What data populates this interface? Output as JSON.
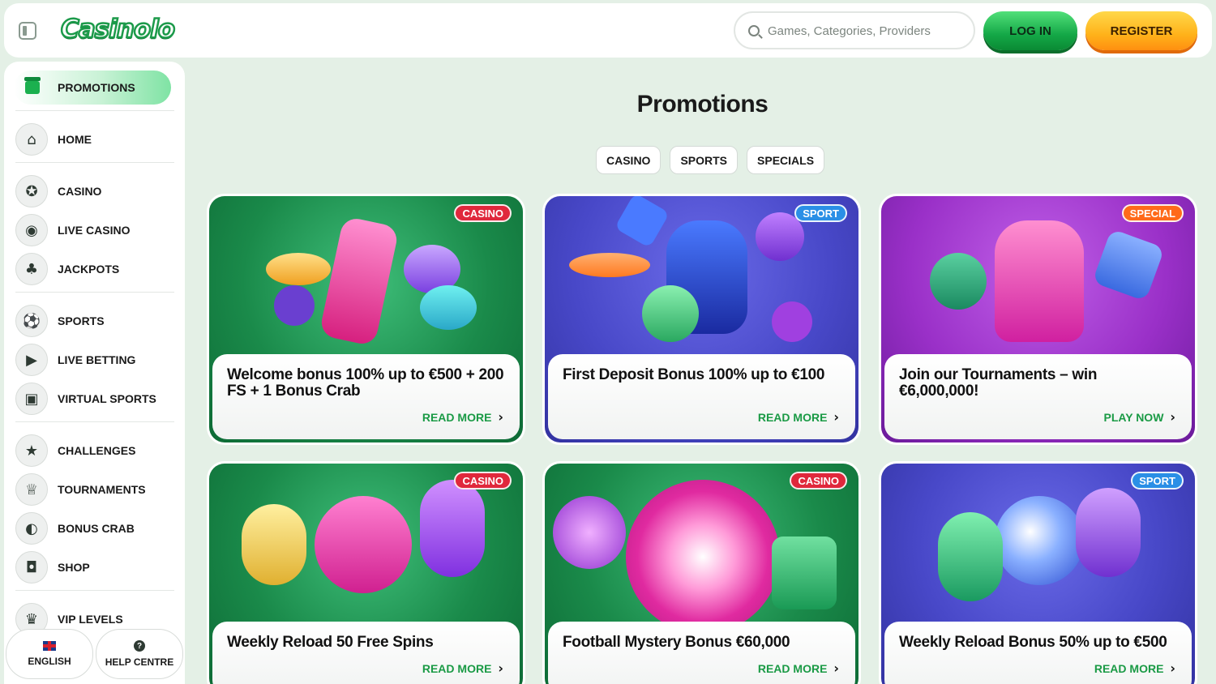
{
  "header": {
    "logo": "Casinolo",
    "search_placeholder": "Games, Categories, Providers",
    "login_label": "LOG IN",
    "register_label": "REGISTER"
  },
  "sidebar": {
    "promotions_label": "PROMOTIONS",
    "items": [
      {
        "label": "HOME",
        "icon": "home-icon",
        "glyph": "⌂"
      },
      {
        "label": "CASINO",
        "icon": "casino-chip-icon",
        "glyph": "✪"
      },
      {
        "label": "LIVE CASINO",
        "icon": "roulette-icon",
        "glyph": "◉"
      },
      {
        "label": "JACKPOTS",
        "icon": "club-icon",
        "glyph": "♣"
      },
      {
        "label": "SPORTS",
        "icon": "football-icon",
        "glyph": "⚽"
      },
      {
        "label": "LIVE BETTING",
        "icon": "live-screen-icon",
        "glyph": "▶"
      },
      {
        "label": "VIRTUAL SPORTS",
        "icon": "virtual-monitor-icon",
        "glyph": "▣"
      },
      {
        "label": "CHALLENGES",
        "icon": "star-podium-icon",
        "glyph": "★"
      },
      {
        "label": "TOURNAMENTS",
        "icon": "trophy-icon",
        "glyph": "♕"
      },
      {
        "label": "BONUS CRAB",
        "icon": "crab-claw-icon",
        "glyph": "◐"
      },
      {
        "label": "SHOP",
        "icon": "shopping-bag-icon",
        "glyph": "◘"
      },
      {
        "label": "VIP LEVELS",
        "icon": "crown-icon",
        "glyph": "♛"
      }
    ],
    "language_label": "ENGLISH",
    "help_label": "HELP CENTRE"
  },
  "main": {
    "title": "Promotions",
    "filters": [
      "CASINO",
      "SPORTS",
      "SPECIALS"
    ],
    "cards": [
      {
        "badge": "CASINO",
        "title": "Welcome bonus 100% up to €500 + 200 FS + 1 Bonus Crab",
        "cta": "READ MORE"
      },
      {
        "badge": "SPORT",
        "title": "First Deposit Bonus 100% up to €100",
        "cta": "READ MORE"
      },
      {
        "badge": "SPECIAL",
        "title": "Join our Tournaments – win €6,000,000!",
        "cta": "PLAY NOW"
      },
      {
        "badge": "CASINO",
        "title": "Weekly Reload 50 Free Spins",
        "cta": "READ MORE"
      },
      {
        "badge": "CASINO",
        "title": "Football Mystery Bonus €60,000",
        "cta": "READ MORE"
      },
      {
        "badge": "SPORT",
        "title": "Weekly Reload Bonus 50% up to €500",
        "cta": "READ MORE"
      }
    ]
  },
  "colors": {
    "page_bg": "#e4f0e6",
    "brand_green": "#1c9a4a",
    "login_green": "#14a847",
    "register_orange": "#ffb21a",
    "cta_green": "#1a9a45",
    "badge_casino": "#e0283c",
    "badge_sport": "#2a8fe6",
    "badge_special": "#ff6a1a"
  }
}
